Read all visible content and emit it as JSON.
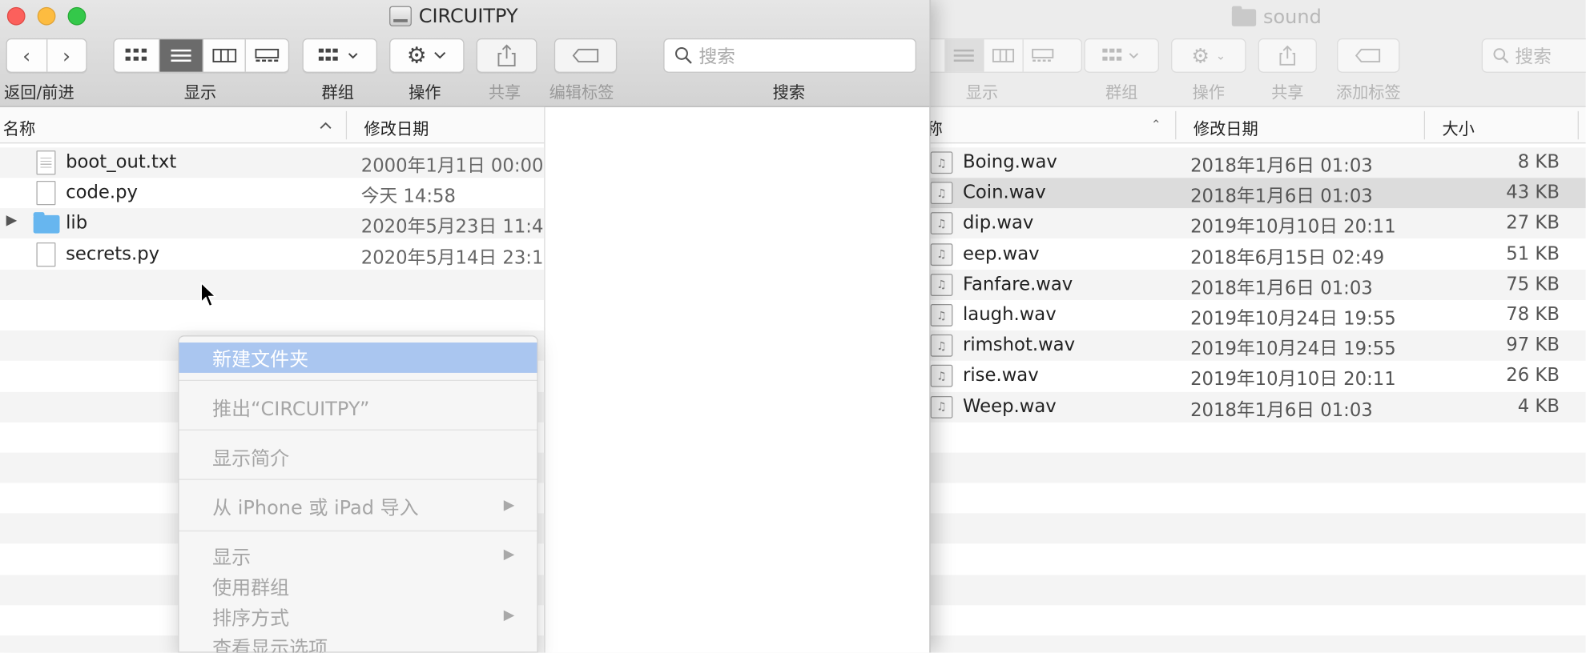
{
  "front_window": {
    "title": "CIRCUITPY",
    "toolbar_labels": {
      "nav": "返回/前进",
      "view": "显示",
      "group": "群组",
      "action": "操作",
      "share": "共享",
      "tags": "编辑标签",
      "search": "搜索"
    },
    "search_placeholder": "搜索",
    "columns": {
      "name": "名称",
      "modified": "修改日期"
    },
    "files": [
      {
        "name": "boot_out.txt",
        "date": "2000年1月1日 00:00"
      },
      {
        "name": "code.py",
        "date": "今天 14:58"
      },
      {
        "name": "lib",
        "date": "2020年5月23日 11:4"
      },
      {
        "name": "secrets.py",
        "date": "2020年5月14日 23:1"
      }
    ]
  },
  "back_window": {
    "title": "sound",
    "toolbar_labels": {
      "view": "显示",
      "group": "群组",
      "action": "操作",
      "share": "共享",
      "tags": "添加标签"
    },
    "search_placeholder": "搜索",
    "columns": {
      "name": "称",
      "modified": "修改日期",
      "size": "大小"
    },
    "files": [
      {
        "name": "Boing.wav",
        "date": "2018年1月6日 01:03",
        "size": "8 KB"
      },
      {
        "name": "Coin.wav",
        "date": "2018年1月6日 01:03",
        "size": "43 KB"
      },
      {
        "name": "dip.wav",
        "date": "2019年10月10日 20:11",
        "size": "27 KB"
      },
      {
        "name": "eep.wav",
        "date": "2018年6月15日 02:49",
        "size": "51 KB"
      },
      {
        "name": "Fanfare.wav",
        "date": "2018年1月6日 01:03",
        "size": "75 KB"
      },
      {
        "name": "laugh.wav",
        "date": "2019年10月24日 19:55",
        "size": "78 KB"
      },
      {
        "name": "rimshot.wav",
        "date": "2019年10月24日 19:55",
        "size": "97 KB"
      },
      {
        "name": "rise.wav",
        "date": "2019年10月10日 20:11",
        "size": "26 KB"
      },
      {
        "name": "Weep.wav",
        "date": "2018年1月6日 01:03",
        "size": "4 KB"
      }
    ]
  },
  "context_menu": {
    "items": [
      "新建文件夹",
      "推出“CIRCUITPY”",
      "显示简介",
      "从 iPhone 或 iPad 导入",
      "显示",
      "使用群组",
      "排序方式",
      "查看显示选项"
    ]
  },
  "colors": {
    "accent": "#aac6f0",
    "folder": "#67b6ef",
    "close": "#fc605c",
    "minimize": "#fdbc40",
    "zoom": "#34c84a"
  }
}
